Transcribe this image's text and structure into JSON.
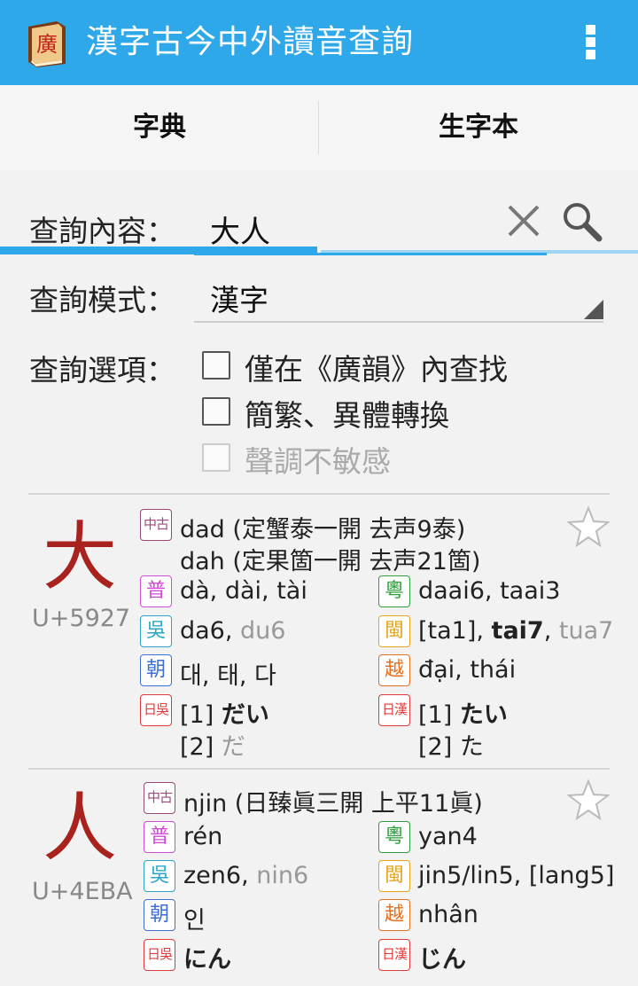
{
  "appbar": {
    "title": "漢字古今中外讀音查詢",
    "logo_icon": "book-icon",
    "logo_char": "廣",
    "menu_icon": "overflow-menu-icon"
  },
  "tabs": [
    {
      "label": "字典"
    },
    {
      "label": "生字本"
    }
  ],
  "form": {
    "query_label": "查詢內容：",
    "query_value": "大人",
    "mode_label": "查詢模式：",
    "mode_value": "漢字",
    "options_label": "查詢選項：",
    "options": [
      {
        "label": "僅在《廣韻》內查找",
        "checked": false,
        "enabled": true
      },
      {
        "label": "簡繁、異體轉換",
        "checked": false,
        "enabled": true
      },
      {
        "label": "聲調不敏感",
        "checked": false,
        "enabled": false
      }
    ]
  },
  "badges": {
    "mc": "中古",
    "mandarin": "普",
    "cantonese": "粵",
    "wu": "吳",
    "minnan": "閩",
    "korean": "朝",
    "vietnamese": "越",
    "jp_go": "日吳",
    "jp_kan": "日漢"
  },
  "colors": {
    "appbar": "#2ea8e8",
    "char": "#a8231d",
    "mc": "#9c4a7a",
    "mandarin": "#d14ad6",
    "cantonese": "#2e9e3e",
    "wu": "#2aa6c9",
    "minnan": "#e6a41a",
    "korean": "#3d6fd6",
    "vietnamese": "#e57020",
    "japanese": "#e03a3a"
  },
  "entries": [
    {
      "char": "大",
      "code": "U+5927",
      "mc": [
        "dad (定蟹泰一開 去声9泰)",
        "dah (定果箇一開 去声21箇)"
      ],
      "mandarin": "dà, dài, tài",
      "cantonese": "daai6, taai3",
      "wu_main": "da6, ",
      "wu_alt": "du6",
      "minnan_pre": "[ta1], ",
      "minnan_bold": "tai7",
      "minnan_post": ", ",
      "minnan_alt": "tua7",
      "korean": "대, 태, 다",
      "vietnamese": "đại, thái",
      "jp_go_1_pre": "[1] ",
      "jp_go_1": "だい",
      "jp_go_2_pre": "[2] ",
      "jp_go_2": "だ",
      "jp_kan_1_pre": "[1] ",
      "jp_kan_1": "たい",
      "jp_kan_2_pre": "[2] ",
      "jp_kan_2": "た"
    },
    {
      "char": "人",
      "code": "U+4EBA",
      "mc": [
        "njin (日臻眞三開 上平11眞)"
      ],
      "mandarin": "rén",
      "cantonese": "yan4",
      "wu_main": "zen6, ",
      "wu_alt": "nin6",
      "minnan": "jin5/lin5, [lang5]",
      "korean": "인",
      "vietnamese": "nhân",
      "jp_go": "にん",
      "jp_kan": "じん"
    }
  ]
}
